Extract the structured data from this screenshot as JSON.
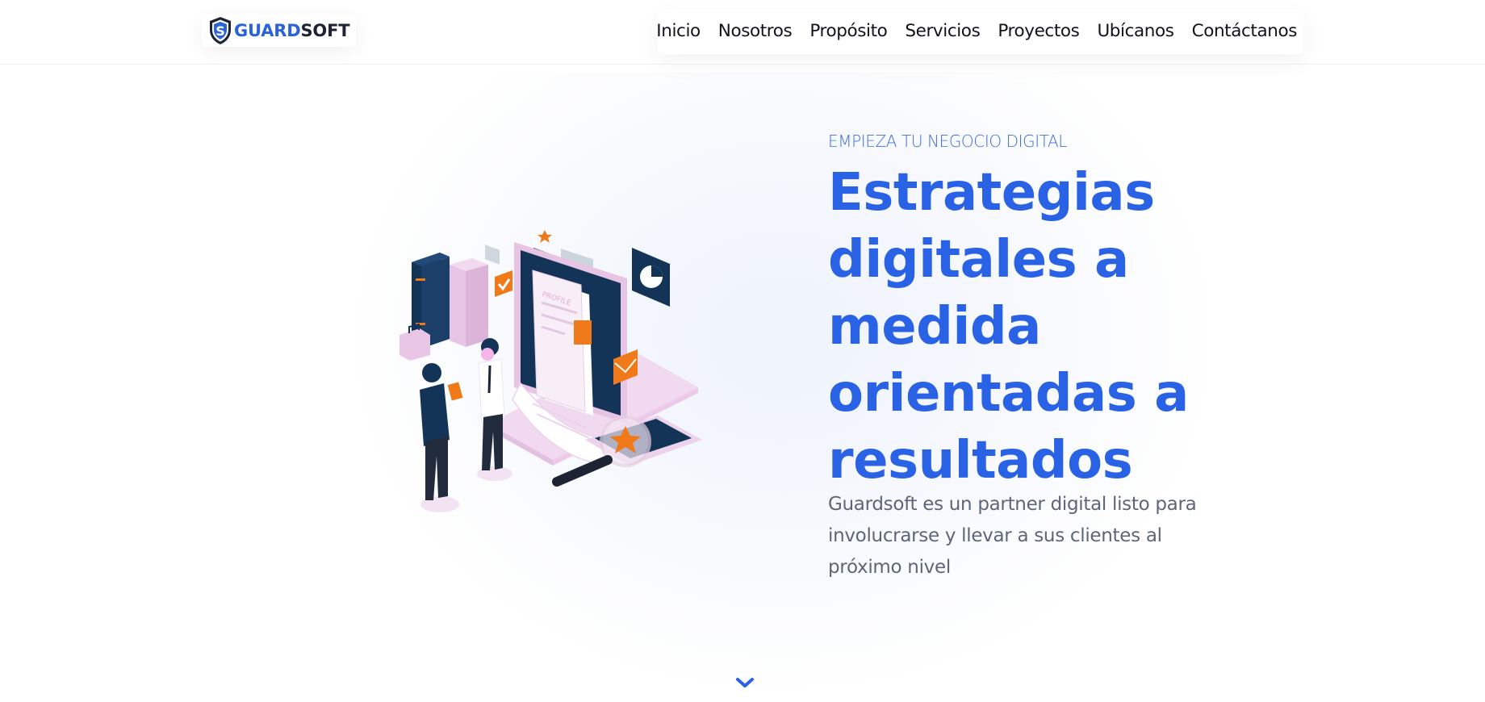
{
  "brand": {
    "name_part1": "GUARD",
    "name_part2": "SOFT",
    "logo_icon": "shield-s-icon",
    "primary_color": "#2a62e6",
    "dark_color": "#1c2333"
  },
  "nav": {
    "items": [
      {
        "label": "Inicio"
      },
      {
        "label": "Nosotros"
      },
      {
        "label": "Propósito"
      },
      {
        "label": "Servicios"
      },
      {
        "label": "Proyectos"
      },
      {
        "label": "Ubícanos"
      },
      {
        "label": "Contáctanos"
      }
    ]
  },
  "hero": {
    "eyebrow": "EMPIEZA TU NEGOCIO DIGITAL",
    "headline": "Estrategias digitales a medida orientadas a resultados",
    "lead": "Guardsoft es un partner digital listo para involucrarse y llevar a sus clientes al próximo nivel",
    "illustration": "digital-business-isometric-illustration",
    "scroll_icon": "chevron-down-icon"
  }
}
